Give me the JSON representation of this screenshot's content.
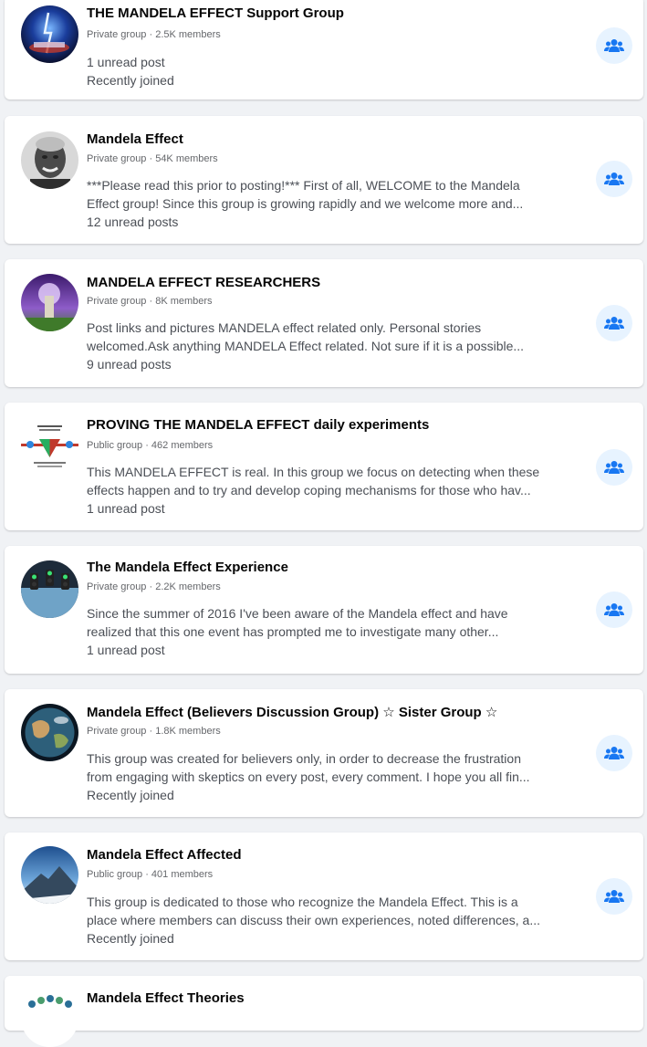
{
  "groups": [
    {
      "name": "THE MANDELA EFFECT Support Group",
      "meta": "Private group · 2.5K members",
      "desc1": "",
      "desc2": "",
      "status": "1 unread post",
      "status2": "Recently joined",
      "avatar": "blue-lightning-avatar"
    },
    {
      "name": "Mandela Effect",
      "meta": "Private group · 54K members",
      "desc1": "***Please read this prior to posting!*** First of all, WELCOME to the Mandela",
      "desc2": "Effect group! Since this group is growing rapidly and we welcome more and...",
      "status": "12 unread posts",
      "avatar": "portrait-avatar"
    },
    {
      "name": "MANDELA EFFECT RESEARCHERS",
      "meta": "Private group · 8K members",
      "desc1": "Post links and pictures MANDELA effect related only. Personal stories",
      "desc2": "welcomed.Ask anything MANDELA Effect related. Not sure if it is a possible...",
      "status": "9 unread posts",
      "avatar": "purple-tower-avatar"
    },
    {
      "name": "PROVING THE MANDELA EFFECT daily experiments",
      "meta": "Public group · 462 members",
      "desc1": "This MANDELA EFFECT is real. In this group we focus on detecting when these",
      "desc2": "effects happen and to try and develop coping mechanisms for those who hav...",
      "status": "1 unread post",
      "avatar": "triangle-diagram-avatar"
    },
    {
      "name": "The Mandela Effect Experience",
      "meta": "Private group · 2.2K members",
      "desc1": "Since the summer of 2016 I've been aware of the Mandela effect and have",
      "desc2": "realized that this one event has prompted me to investigate many other...",
      "status": "1 unread post",
      "avatar": "traffic-lights-avatar"
    },
    {
      "name": "Mandela Effect (Believers Discussion Group) ☆ Sister Group ☆",
      "meta": "Private group · 1.8K members",
      "desc1": "This group was created for believers only, in order to decrease the frustration",
      "desc2": "from engaging with skeptics on every post, every comment. I hope you all fin...",
      "status": "Recently joined",
      "avatar": "earth-avatar"
    },
    {
      "name": "Mandela Effect Affected",
      "meta": "Public group · 401 members",
      "desc1": "This group is dedicated to those who recognize the Mandela Effect. This is a",
      "desc2": "place where members can discuss their own experiences, noted differences, a...",
      "status": "Recently joined",
      "avatar": "mountain-avatar"
    },
    {
      "name": "Mandela Effect Theories",
      "avatar": "crowd-avatar"
    }
  ],
  "colors": {
    "page_bg": "#f0f2f5",
    "card_bg": "#ffffff",
    "accent": "#1877f2",
    "accent_light": "#e7f3ff",
    "meta_text": "#65676b"
  },
  "icons": {
    "join_button": "groups-icon"
  }
}
